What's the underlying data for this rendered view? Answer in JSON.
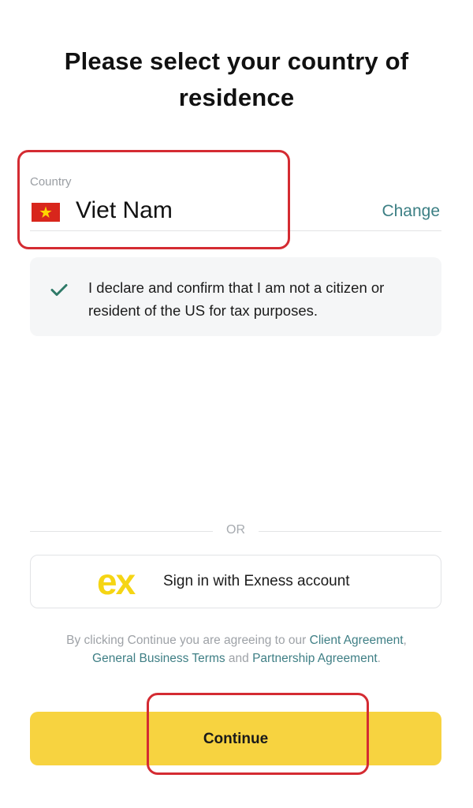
{
  "header": {
    "title_line1": "Please select your country of",
    "title_line2": "residence"
  },
  "country": {
    "label": "Country",
    "value": "Viet Nam",
    "flag_icon": "vietnam-flag-icon",
    "change_label": "Change"
  },
  "declaration": {
    "checked": true,
    "check_icon": "checkmark-icon",
    "text": "I declare and confirm that I am not a citizen or resident of the US for tax purposes."
  },
  "divider": {
    "or_label": "OR"
  },
  "exness_signin": {
    "logo_text": "ex",
    "label": "Sign in with Exness account"
  },
  "legal": {
    "prefix": "By clicking Continue you are agreeing to our ",
    "link1": "Client Agreement",
    "sep1": ", ",
    "link2": "General Business Terms",
    "sep2": " and ",
    "link3": "Partnership Agreement",
    "suffix": "."
  },
  "continue": {
    "label": "Continue"
  },
  "colors": {
    "accent_yellow": "#f7d340",
    "link_teal": "#3c7f84",
    "check_green": "#2f7a68",
    "highlight_red": "#d42b32",
    "flag_red": "#d8261c",
    "flag_star": "#ffd500"
  }
}
